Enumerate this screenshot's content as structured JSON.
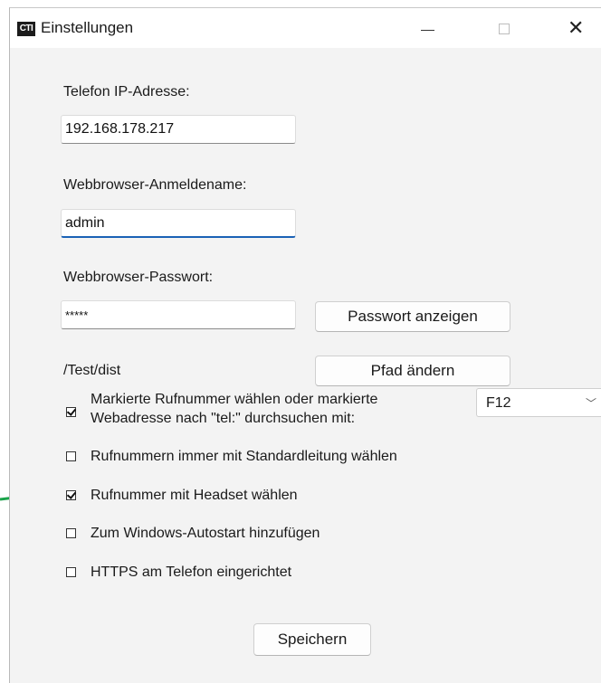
{
  "window": {
    "app_icon_text": "CTI",
    "title": "Einstellungen",
    "minimize_glyph": "—",
    "close_glyph": "✕"
  },
  "form": {
    "phone_ip_label": "Telefon IP-Adresse:",
    "phone_ip_value": "192.168.178.217",
    "web_user_label": "Webbrowser-Anmeldename:",
    "web_user_value": "admin",
    "web_password_label": "Webbrowser-Passwort:",
    "web_password_value": "*****",
    "show_password_button": "Passwort anzeigen",
    "path_text": "/Test/dist",
    "change_path_button": "Pfad ändern"
  },
  "options": {
    "dial_marked": {
      "label_line1": "Markierte Rufnummer wählen oder markierte",
      "label_line2": "Webadresse nach \"tel:\" durchsuchen mit:",
      "checked": true
    },
    "hotkey_select": {
      "value": "F12"
    },
    "always_default_line": {
      "label": "Rufnummern immer mit Standardleitung wählen",
      "checked": false
    },
    "headset": {
      "label": "Rufnummer mit Headset wählen",
      "checked": true
    },
    "autostart": {
      "label": "Zum Windows-Autostart hinzufügen",
      "checked": false
    },
    "https_phone": {
      "label": "HTTPS am Telefon eingerichtet",
      "checked": false
    }
  },
  "save_button": "Speichern",
  "colors": {
    "arrow": "#1aa34a",
    "focus": "#1a62b6"
  },
  "icons": {
    "chevron": "chevron-down-icon",
    "arrow": "green-arrow-icon"
  }
}
